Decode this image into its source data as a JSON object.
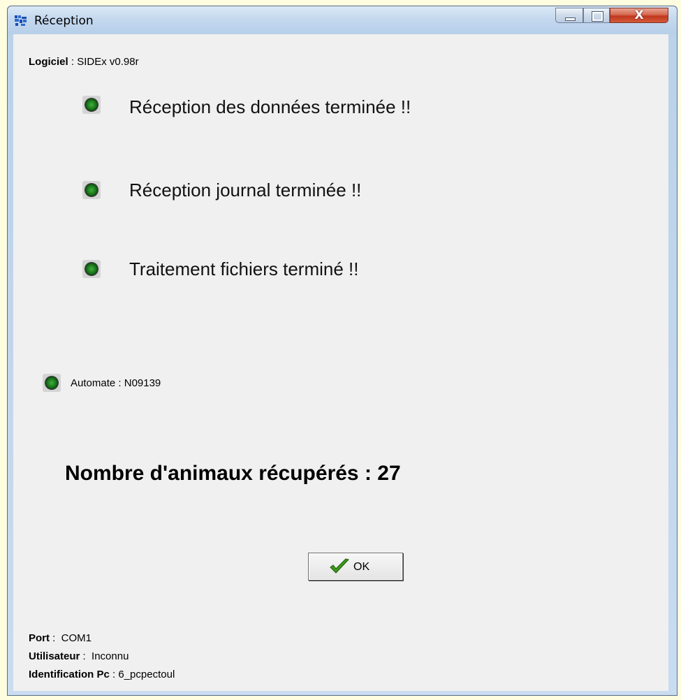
{
  "window": {
    "title": "Réception",
    "controls": {
      "close_glyph": "X"
    }
  },
  "header": {
    "software_label": "Logiciel",
    "software_value": "SIDEx v0.98r"
  },
  "status_items": [
    {
      "icon": "green-led-icon",
      "text": "Réception des données terminée !!"
    },
    {
      "icon": "green-led-icon",
      "text": "Réception journal terminée !!"
    },
    {
      "icon": "green-led-icon",
      "text": "Traitement fichiers terminé !!"
    }
  ],
  "automate": {
    "label": "Automate",
    "value": "N09139"
  },
  "result": {
    "text": "Nombre d'animaux récupérés : 27"
  },
  "ok_button": {
    "label": "OK",
    "icon": "checkmark-icon"
  },
  "footer": {
    "port_label": "Port",
    "port_value": "COM1",
    "user_label": "Utilisateur",
    "user_value": "Inconnu",
    "pc_label": "Identification Pc",
    "pc_value": "6_pcpectoul"
  },
  "colors": {
    "led": "#2a8f2a",
    "check": "#3a9a1a",
    "title_bar": "#c4d8ee",
    "close_button": "#c0381e",
    "background": "#f0f0f0"
  }
}
